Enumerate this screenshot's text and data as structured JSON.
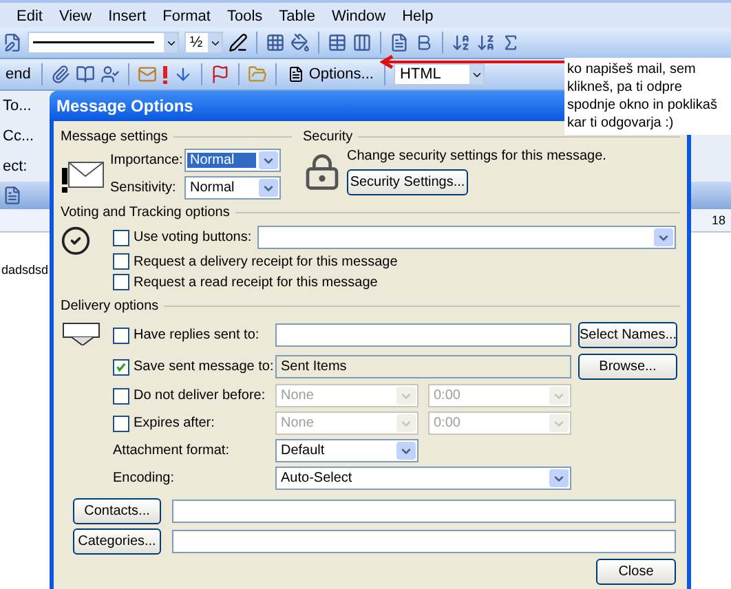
{
  "menu": [
    "Edit",
    "View",
    "Insert",
    "Format",
    "Tools",
    "Table",
    "Window",
    "Help"
  ],
  "toolbar": {
    "line_weight": "½",
    "send": "end",
    "options": "Options...",
    "format": "HTML"
  },
  "header_fields": [
    "To...",
    "Cc...",
    "ect:"
  ],
  "ruler_mark": "18",
  "document_text": "dadsdsd",
  "note": "ko napišeš mail, sem klikneš, pa ti odpre spodnje okno in poklikaš kar ti odgovarja :)",
  "dialog": {
    "title": "Message Options",
    "message_settings": {
      "label": "Message settings",
      "importance": {
        "label": "Importance:",
        "value": "Normal",
        "selected": true
      },
      "sensitivity": {
        "label": "Sensitivity:",
        "value": "Normal",
        "selected": false
      }
    },
    "security": {
      "label": "Security",
      "text": "Change security settings for this message.",
      "button": "Security Settings..."
    },
    "voting": {
      "label": "Voting and Tracking options",
      "options": [
        {
          "kind": "combo",
          "label": "Use voting buttons:",
          "checked": false
        },
        {
          "kind": "plain",
          "label": "Request a delivery receipt for this message",
          "checked": false
        },
        {
          "kind": "plain",
          "label": "Request a read receipt for this message",
          "checked": false
        }
      ]
    },
    "delivery": {
      "label": "Delivery options",
      "rows": [
        {
          "kind": "text",
          "label": "Have replies sent to:",
          "checked": false,
          "editable": true,
          "button": "Select Names..."
        },
        {
          "kind": "text",
          "label": "Save sent message to:",
          "checked": true,
          "editable": false,
          "value": "Sent Items",
          "button": "Browse..."
        },
        {
          "kind": "datetime",
          "label": "Do not deliver before:",
          "checked": false,
          "date": "None",
          "time": "0:00",
          "disabled": true
        },
        {
          "kind": "datetime",
          "label": "Expires after:",
          "checked": false,
          "date": "None",
          "time": "0:00",
          "disabled": true
        }
      ],
      "attachment_format": {
        "label": "Attachment format:",
        "value": "Default"
      },
      "encoding": {
        "label": "Encoding:",
        "value": "Auto-Select"
      }
    },
    "contacts": {
      "button": "Contacts..."
    },
    "categories": {
      "button": "Categories..."
    },
    "close": "Close"
  }
}
